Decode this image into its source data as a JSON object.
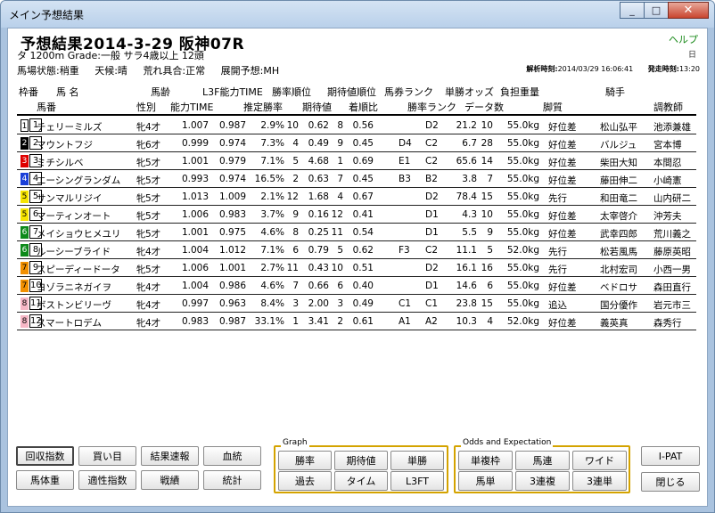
{
  "window": {
    "title": "メイン予想結果",
    "minimize": "_",
    "maximize": "□",
    "close": "✕"
  },
  "header": {
    "race_title": "予想結果2014-3-29 阪神07R",
    "help": "ヘルプ",
    "mini_icon": "日",
    "info_line1": "タ 1200m  Grade:一般  サラ4歳以上  12頭",
    "track": "馬場状態:稍重",
    "weather": "天候:晴",
    "chaos": "荒れ具合:正常",
    "pace": "展開予想:MH",
    "analysis_time_label": "解析時刻:",
    "analysis_time": "2014/03/29 16:06:41",
    "post_time_label": "発走時刻:",
    "post_time": "13:20"
  },
  "columns_row1": [
    "枠番",
    "馬 名",
    "馬齢",
    "L3F能力TIME",
    "勝率順位",
    "期待値順位",
    "馬券ランク",
    "単勝オッズ",
    "負担重量",
    "騎手"
  ],
  "columns_row2": [
    "馬番",
    "性別",
    "能力TIME",
    "推定勝率",
    "期待値",
    "着順比",
    "勝率ランク",
    "データ数",
    "脚質",
    "調教師"
  ],
  "rows": [
    {
      "waku": "1",
      "ban": "1",
      "name": "チェリーミルズ",
      "sex": "牝",
      "age": "4才",
      "l3f": "1.007",
      "time": "0.987",
      "win": "2.9%",
      "wr": "10",
      "ev": "0.62",
      "er": "8",
      "ratio": "0.56",
      "ticket": "",
      "rank": "D2",
      "odds": "21.2",
      "data": "10",
      "weight": "55.0kg",
      "style": "好位差",
      "jockey": "松山弘平",
      "trainer": "池添兼雄"
    },
    {
      "waku": "2",
      "ban": "2",
      "name": "マウントフジ",
      "sex": "牝",
      "age": "6才",
      "l3f": "0.999",
      "time": "0.974",
      "win": "7.3%",
      "wr": "4",
      "ev": "0.49",
      "er": "9",
      "ratio": "0.45",
      "ticket": "D4",
      "rank": "C2",
      "odds": "6.7",
      "data": "28",
      "weight": "55.0kg",
      "style": "好位差",
      "jockey": "バルジュ",
      "trainer": "宮本博"
    },
    {
      "waku": "3",
      "ban": "3",
      "name": "ミチシルベ",
      "sex": "牝",
      "age": "5才",
      "l3f": "1.001",
      "time": "0.979",
      "win": "7.1%",
      "wr": "5",
      "ev": "4.68",
      "er": "1",
      "ratio": "0.69",
      "ticket": "E1",
      "rank": "C2",
      "odds": "65.6",
      "data": "14",
      "weight": "55.0kg",
      "style": "好位差",
      "jockey": "柴田大知",
      "trainer": "本間忍"
    },
    {
      "waku": "4",
      "ban": "4",
      "name": "エーシングランダム",
      "sex": "牝",
      "age": "5才",
      "l3f": "0.993",
      "time": "0.974",
      "win": "16.5%",
      "wr": "2",
      "ev": "0.63",
      "er": "7",
      "ratio": "0.45",
      "ticket": "B3",
      "rank": "B2",
      "odds": "3.8",
      "data": "7",
      "weight": "55.0kg",
      "style": "好位差",
      "jockey": "藤田伸二",
      "trainer": "小崎憲"
    },
    {
      "waku": "5",
      "ban": "5",
      "name": "サンマルリジイ",
      "sex": "牝",
      "age": "5才",
      "l3f": "1.013",
      "time": "1.009",
      "win": "2.1%",
      "wr": "12",
      "ev": "1.68",
      "er": "4",
      "ratio": "0.67",
      "ticket": "",
      "rank": "D2",
      "odds": "78.4",
      "data": "15",
      "weight": "55.0kg",
      "style": "先行",
      "jockey": "和田竜二",
      "trainer": "山内研二"
    },
    {
      "waku": "5",
      "ban": "6",
      "name": "マーティンオート",
      "sex": "牝",
      "age": "5才",
      "l3f": "1.006",
      "time": "0.983",
      "win": "3.7%",
      "wr": "9",
      "ev": "0.16",
      "er": "12",
      "ratio": "0.41",
      "ticket": "",
      "rank": "D1",
      "odds": "4.3",
      "data": "10",
      "weight": "55.0kg",
      "style": "好位差",
      "jockey": "太宰啓介",
      "trainer": "沖芳夫"
    },
    {
      "waku": "6",
      "ban": "7",
      "name": "メイショウヒメユリ",
      "sex": "牝",
      "age": "5才",
      "l3f": "1.001",
      "time": "0.975",
      "win": "4.6%",
      "wr": "8",
      "ev": "0.25",
      "er": "11",
      "ratio": "0.54",
      "ticket": "",
      "rank": "D1",
      "odds": "5.5",
      "data": "9",
      "weight": "55.0kg",
      "style": "好位差",
      "jockey": "武幸四郎",
      "trainer": "荒川義之"
    },
    {
      "waku": "6",
      "ban": "8",
      "name": "ルーシーブライド",
      "sex": "牝",
      "age": "4才",
      "l3f": "1.004",
      "time": "1.012",
      "win": "7.1%",
      "wr": "6",
      "ev": "0.79",
      "er": "5",
      "ratio": "0.62",
      "ticket": "F3",
      "rank": "C2",
      "odds": "11.1",
      "data": "5",
      "weight": "52.0kg",
      "style": "先行",
      "jockey": "松若風馬",
      "trainer": "藤原英昭"
    },
    {
      "waku": "7",
      "ban": "9",
      "name": "スピーディードータ",
      "sex": "牝",
      "age": "5才",
      "l3f": "1.006",
      "time": "1.001",
      "win": "2.7%",
      "wr": "11",
      "ev": "0.43",
      "er": "10",
      "ratio": "0.51",
      "ticket": "",
      "rank": "D2",
      "odds": "16.1",
      "data": "16",
      "weight": "55.0kg",
      "style": "先行",
      "jockey": "北村宏司",
      "trainer": "小西一男"
    },
    {
      "waku": "7",
      "ban": "10",
      "name": "ヨゾラニネガイヲ",
      "sex": "牝",
      "age": "4才",
      "l3f": "1.004",
      "time": "0.986",
      "win": "4.6%",
      "wr": "7",
      "ev": "0.66",
      "er": "6",
      "ratio": "0.40",
      "ticket": "",
      "rank": "D1",
      "odds": "14.6",
      "data": "6",
      "weight": "55.0kg",
      "style": "好位差",
      "jockey": "ベドロサ",
      "trainer": "森田直行"
    },
    {
      "waku": "8",
      "ban": "11",
      "name": "ボストンビリーヴ",
      "sex": "牝",
      "age": "4才",
      "l3f": "0.997",
      "time": "0.963",
      "win": "8.4%",
      "wr": "3",
      "ev": "2.00",
      "er": "3",
      "ratio": "0.49",
      "ticket": "C1",
      "rank": "C1",
      "odds": "23.8",
      "data": "15",
      "weight": "55.0kg",
      "style": "追込",
      "jockey": "国分優作",
      "trainer": "岩元市三"
    },
    {
      "waku": "8",
      "ban": "12",
      "name": "スマートロデム",
      "sex": "牝",
      "age": "4才",
      "l3f": "0.983",
      "time": "0.987",
      "win": "33.1%",
      "wr": "1",
      "ev": "3.41",
      "er": "2",
      "ratio": "0.61",
      "ticket": "A1",
      "rank": "A2",
      "odds": "10.3",
      "data": "4",
      "weight": "52.0kg",
      "style": "好位差",
      "jockey": "義英真",
      "trainer": "森秀行"
    }
  ],
  "waku_colors": {
    "1": {
      "bg": "#ffffff",
      "fg": "#000000"
    },
    "2": {
      "bg": "#000000",
      "fg": "#ffffff"
    },
    "3": {
      "bg": "#e00000",
      "fg": "#ffffff"
    },
    "4": {
      "bg": "#1a3fd8",
      "fg": "#ffffff"
    },
    "5": {
      "bg": "#f6e400",
      "fg": "#000000"
    },
    "6": {
      "bg": "#0d8a1a",
      "fg": "#ffffff"
    },
    "7": {
      "bg": "#f29000",
      "fg": "#000000"
    },
    "8": {
      "bg": "#f6b7c6",
      "fg": "#000000"
    }
  },
  "buttons_left": [
    "回収指数",
    "買い目",
    "結果速報",
    "血統",
    "馬体重",
    "適性指数",
    "戦績",
    "統計"
  ],
  "graph_group": {
    "title": "Graph",
    "buttons": [
      "勝率",
      "期待値",
      "単勝",
      "過去",
      "タイム",
      "L3FT"
    ]
  },
  "odds_group": {
    "title": "Odds and Expectation",
    "buttons": [
      "単複枠",
      "馬連",
      "ワイド",
      "馬単",
      "3連複",
      "3連単"
    ]
  },
  "buttons_right": [
    "I-PAT",
    "閉じる"
  ],
  "accent": {
    "group_border": "#d4a300",
    "help_color": "#1a8a1a"
  }
}
